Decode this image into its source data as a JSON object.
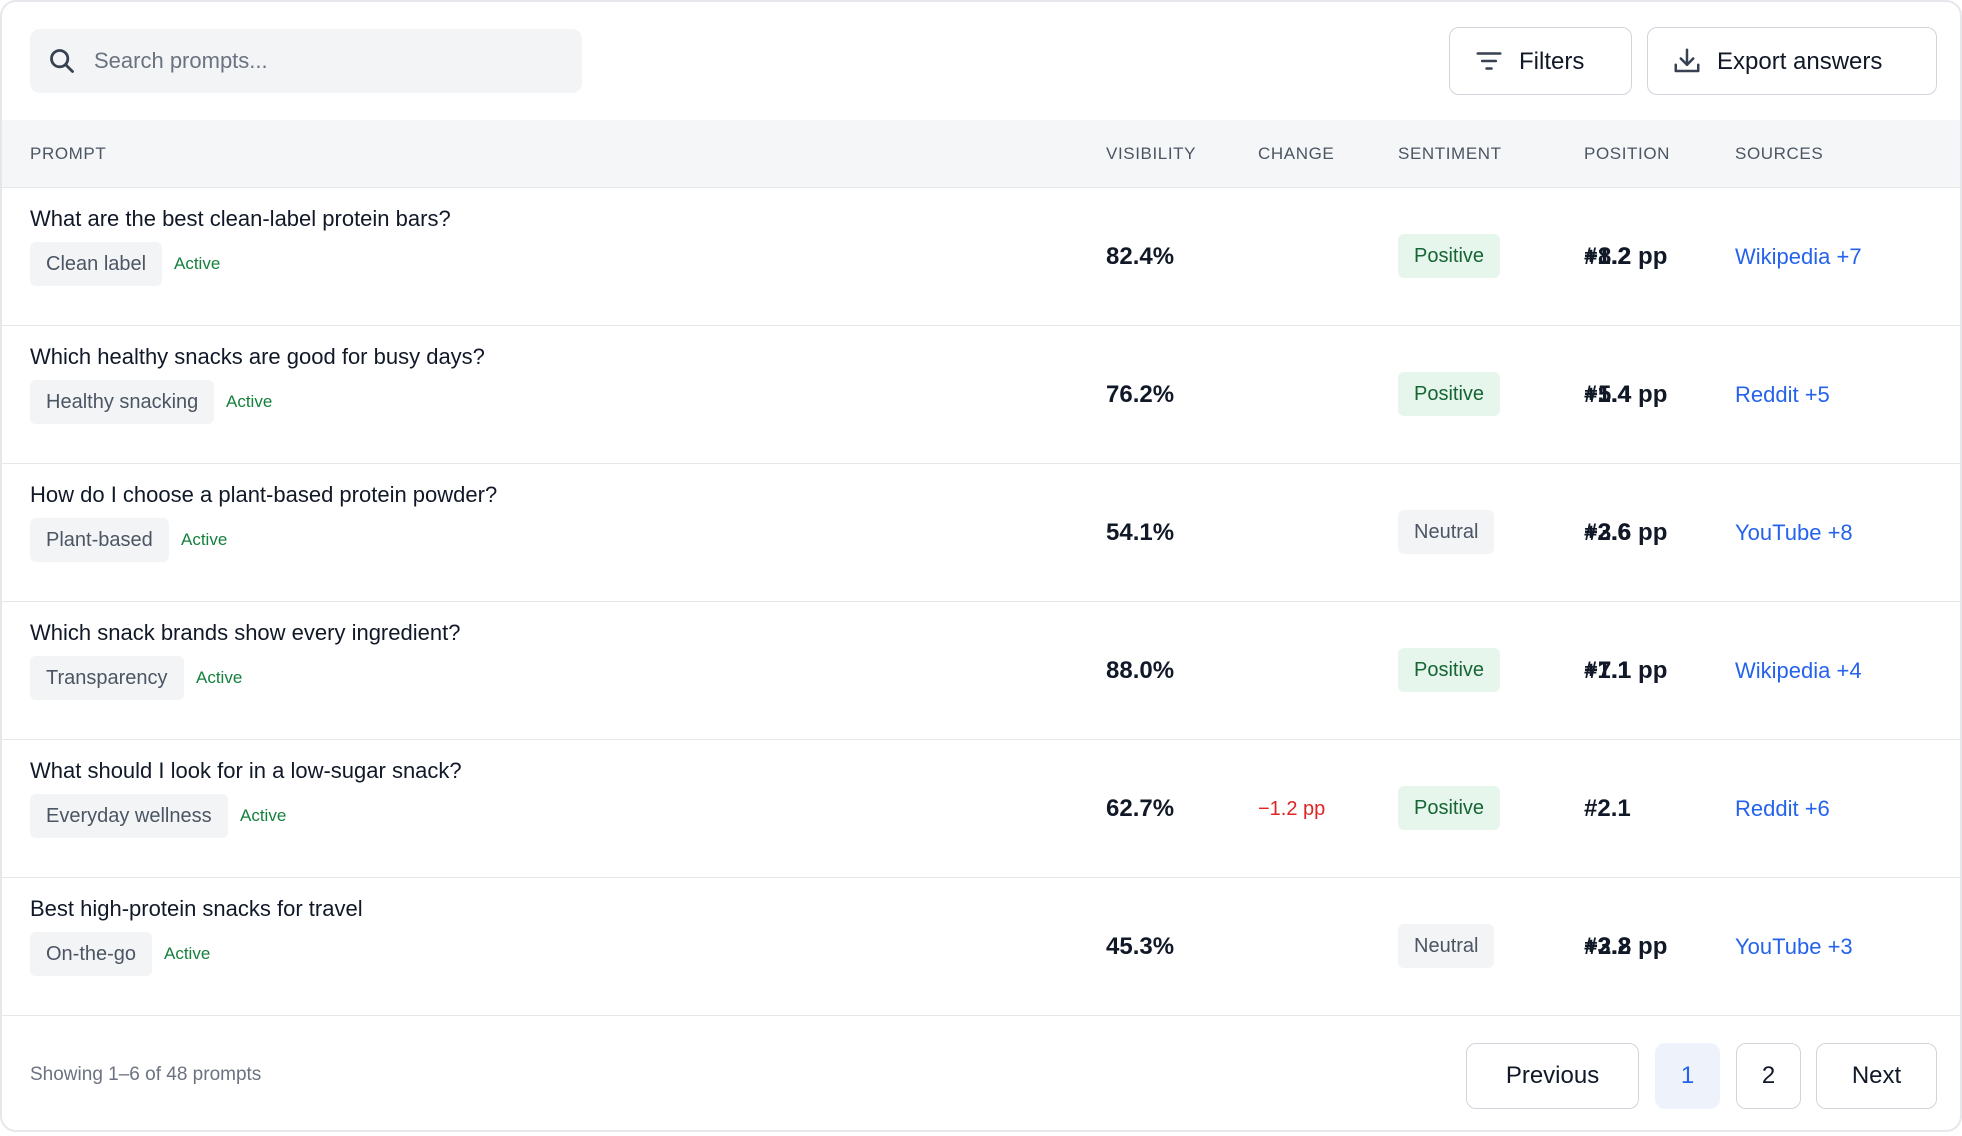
{
  "search": {
    "placeholder": "Search prompts..."
  },
  "toolbar": {
    "filters_label": "Filters",
    "export_label": "Export answers"
  },
  "columns": {
    "prompt": "PROMPT",
    "visibility": "VISIBILITY",
    "change": "CHANGE",
    "sentiment": "SENTIMENT",
    "position": "POSITION",
    "sources": "SOURCES"
  },
  "rows": [
    {
      "question": "What are the best clean-label protein bars?",
      "tag": "Clean label",
      "status": "Active",
      "visibility": "82.4%",
      "change": "+8.2 pp",
      "change_direction": "up",
      "sentiment": "Positive",
      "position": "#1.2",
      "sources": "Wikipedia +7"
    },
    {
      "question": "Which healthy snacks are good for busy days?",
      "tag": "Healthy snacking",
      "status": "Active",
      "visibility": "76.2%",
      "change": "+5.4 pp",
      "change_direction": "up",
      "sentiment": "Positive",
      "position": "#1.4",
      "sources": "Reddit +5"
    },
    {
      "question": "How do I choose a plant-based protein powder?",
      "tag": "Plant-based",
      "status": "Active",
      "visibility": "54.1%",
      "change": "+3.6 pp",
      "change_direction": "up",
      "sentiment": "Neutral",
      "position": "#2.6",
      "sources": "YouTube +8"
    },
    {
      "question": "Which snack brands show every ingredient?",
      "tag": "Transparency",
      "status": "Active",
      "visibility": "88.0%",
      "change": "+7.1 pp",
      "change_direction": "up",
      "sentiment": "Positive",
      "position": "#1.1",
      "sources": "Wikipedia +4"
    },
    {
      "question": "What should I look for in a low-sugar snack?",
      "tag": "Everyday wellness",
      "status": "Active",
      "visibility": "62.7%",
      "change": "−1.2 pp",
      "change_direction": "down",
      "sentiment": "Positive",
      "position": "#2.1",
      "sources": "Reddit +6"
    },
    {
      "question": "Best high-protein snacks for travel",
      "tag": "On-the-go",
      "status": "Active",
      "visibility": "45.3%",
      "change": "+2.8 pp",
      "change_direction": "up",
      "sentiment": "Neutral",
      "position": "#3.2",
      "sources": "YouTube +3"
    }
  ],
  "footer": {
    "info": "Showing 1–6 of 48 prompts",
    "previous": "Previous",
    "pages": [
      "1",
      "2"
    ],
    "current_page": "1",
    "next": "Next"
  },
  "colors": {
    "link": "#2563eb",
    "positive_text": "#15803d",
    "negative_text": "#dc2626",
    "positive_badge_bg": "#e7f6ec",
    "neutral_badge_bg": "#f3f4f6",
    "active_page_bg": "#eef2fb"
  },
  "icons": {
    "search": "search-icon",
    "filters": "filter-lines-icon",
    "export": "download-icon"
  }
}
